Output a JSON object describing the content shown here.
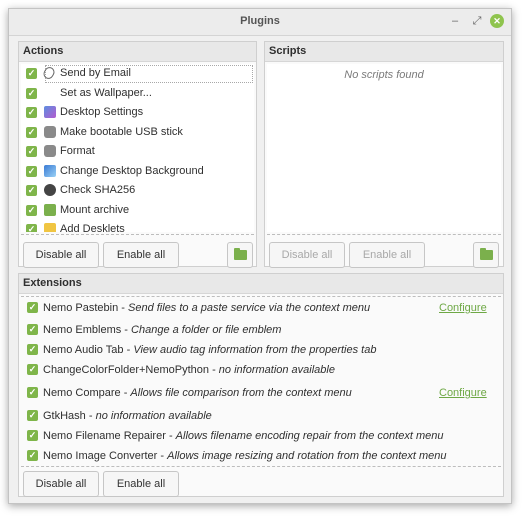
{
  "window": {
    "title": "Plugins"
  },
  "actions": {
    "header": "Actions",
    "items": [
      {
        "label": "Send by Email",
        "icon": "paperclip-icon",
        "checked": true
      },
      {
        "label": "Set as Wallpaper...",
        "icon": "",
        "checked": true
      },
      {
        "label": "Desktop Settings",
        "icon": "desktop-settings-icon",
        "checked": true
      },
      {
        "label": "Make bootable USB stick",
        "icon": "usb-icon",
        "checked": true
      },
      {
        "label": "Format",
        "icon": "usb-icon",
        "checked": true
      },
      {
        "label": "Change Desktop Background",
        "icon": "background-icon",
        "checked": true
      },
      {
        "label": "Check SHA256",
        "icon": "gear-icon",
        "checked": true
      },
      {
        "label": "Mount archive",
        "icon": "folder-icon",
        "checked": true
      },
      {
        "label": "Add Desklets",
        "icon": "desklet-icon",
        "checked": true
      }
    ],
    "disable_all": "Disable all",
    "enable_all": "Enable all"
  },
  "scripts": {
    "header": "Scripts",
    "empty_text": "No scripts found",
    "disable_all": "Disable all",
    "enable_all": "Enable all"
  },
  "extensions": {
    "header": "Extensions",
    "items": [
      {
        "name": "Nemo Pastebin",
        "desc": "Send files to a paste service via the context menu",
        "configure": "Configure",
        "checked": true
      },
      {
        "name": "Nemo Emblems",
        "desc": "Change a folder or file emblem",
        "configure": "",
        "checked": true
      },
      {
        "name": "Nemo Audio Tab",
        "desc": "View audio tag information from the properties tab",
        "configure": "",
        "checked": true
      },
      {
        "name": "ChangeColorFolder+NemoPython",
        "desc": "no information available",
        "configure": "",
        "checked": true
      },
      {
        "name": "Nemo Compare",
        "desc": "Allows file comparison from the context menu",
        "configure": "Configure",
        "checked": true
      },
      {
        "name": "GtkHash",
        "desc": "no information available",
        "configure": "",
        "checked": true
      },
      {
        "name": "Nemo Filename Repairer",
        "desc": "Allows filename encoding repair from the context menu",
        "configure": "",
        "checked": true
      },
      {
        "name": "Nemo Image Converter",
        "desc": "Allows image resizing and rotation from the context menu",
        "configure": "",
        "checked": true
      }
    ],
    "disable_all": "Disable all",
    "enable_all": "Enable all"
  },
  "colors": {
    "accent": "#7fb54a",
    "link": "#6ea845"
  }
}
